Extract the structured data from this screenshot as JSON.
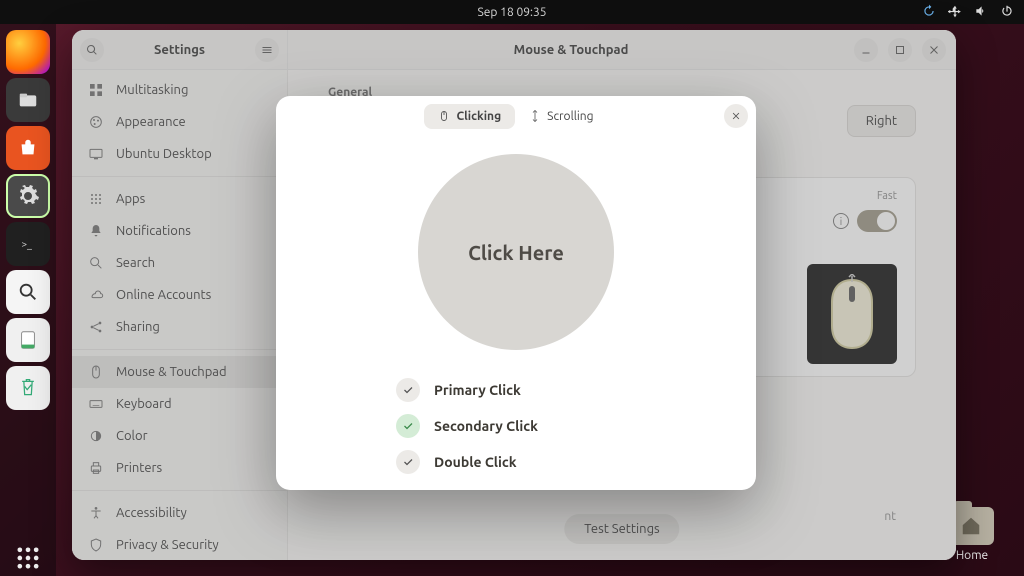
{
  "topbar": {
    "datetime": "Sep 18  09:35"
  },
  "dock": {
    "apps_label": "Show Applications"
  },
  "desktop": {
    "home_label": "Home"
  },
  "window": {
    "sidebar_title": "Settings",
    "main_title": "Mouse & Touchpad"
  },
  "sidebar": {
    "items": [
      {
        "label": "Multitasking"
      },
      {
        "label": "Appearance"
      },
      {
        "label": "Ubuntu Desktop"
      },
      {
        "label": "Apps"
      },
      {
        "label": "Notifications"
      },
      {
        "label": "Search"
      },
      {
        "label": "Online Accounts"
      },
      {
        "label": "Sharing"
      },
      {
        "label": "Mouse & Touchpad"
      },
      {
        "label": "Keyboard"
      },
      {
        "label": "Color"
      },
      {
        "label": "Printers"
      },
      {
        "label": "Accessibility"
      },
      {
        "label": "Privacy & Security"
      }
    ]
  },
  "content": {
    "general_label": "General",
    "primary_right": "Right",
    "fast_label": "Fast",
    "hint_partial": "nt",
    "test_button": "Test Settings"
  },
  "modal": {
    "tab_clicking": "Clicking",
    "tab_scrolling": "Scrolling",
    "circle_text": "Click Here",
    "primary": "Primary Click",
    "secondary": "Secondary Click",
    "double": "Double Click"
  }
}
